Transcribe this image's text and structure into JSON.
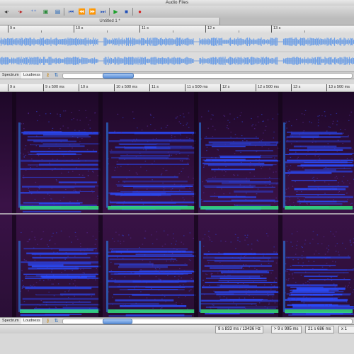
{
  "window": {
    "title": "Audio Files"
  },
  "toolbar": {
    "icons": [
      "cursor-left-arrow-icon",
      "cursor-right-arrow-icon",
      "zoom-icon",
      "record-settings-icon",
      "go-to-start-icon",
      "rewind-icon",
      "fast-forward-icon",
      "go-to-end-icon",
      "play-icon",
      "stop-icon",
      "record-icon"
    ],
    "colors": {
      "transport": "#1f4fb8",
      "play": "#1aa02a",
      "stop": "#1f4fb8",
      "record": "#d81e1e"
    }
  },
  "tab": {
    "label": "Untitled 1 *"
  },
  "ruler_top": {
    "labels": [
      "9 s",
      "10 s",
      "11 s",
      "12 s",
      "13 s"
    ]
  },
  "ruler_mid": {
    "labels": [
      "9 s",
      "9 s 500 ms",
      "10 s",
      "10 s 500 ms",
      "11 s",
      "11 s 500 ms",
      "12 s",
      "12 s 500 ms",
      "13 s",
      "13 s 500 ms"
    ]
  },
  "panel_tabs": {
    "spectrum": "Spectrum",
    "loudness": "Loudness"
  },
  "status": {
    "cursor": "9 s 833 ms / 13436 Hz",
    "selection": "> 9 s 995 ms",
    "length": "21 s 686 ms",
    "zoom": "x 1"
  },
  "colors": {
    "waveform": "#6fa0e6",
    "spectro_bg": "#2a0f36",
    "spectro_blue": "#2a4cff",
    "spectro_green": "#33e07a"
  }
}
